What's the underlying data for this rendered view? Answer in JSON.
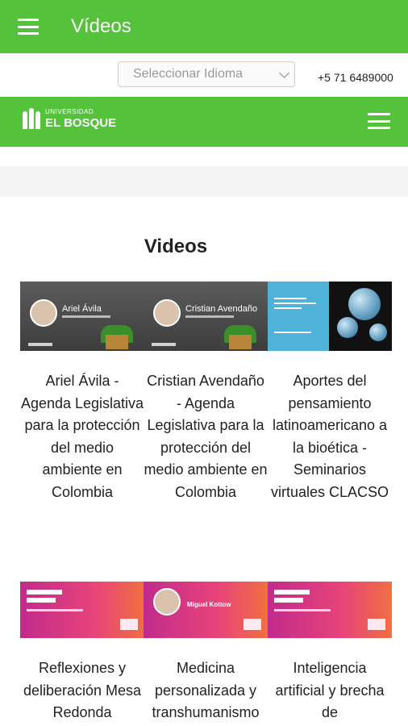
{
  "appbar": {
    "title": "Vídeos",
    "menu_icon": "hamburger-menu-icon"
  },
  "topbar": {
    "language_placeholder": "Seleccionar Idioma",
    "phone": "+5 71 6489000"
  },
  "site_header": {
    "logo_small": "UNIVERSIDAD",
    "logo_name": "EL BOSQUE",
    "menu_icon": "hamburger-menu-icon"
  },
  "section": {
    "title": "Videos"
  },
  "videos": [
    {
      "title": "Ariel Ávila - Agenda Legislativa para la protección del medio ambiente en Colombia",
      "thumb_name": "Ariel Ávila"
    },
    {
      "title": "Cristian Avendaño - Agenda Legislativa para la protección del medio ambiente en Colombia",
      "thumb_name": "Cristian Avendaño"
    },
    {
      "title": "Aportes del pensamiento latinoamericano a la bioética - Seminarios virtuales CLACSO"
    },
    {
      "title": "Reflexiones y deliberación Mesa Redonda"
    },
    {
      "title": "Medicina personalizada y transhumanismo",
      "thumb_name": "Miguel Kottow"
    },
    {
      "title": "Inteligencia artificial y brecha de"
    }
  ],
  "colors": {
    "brand_green": "#55c23c",
    "magenta": "#c12b8b"
  }
}
